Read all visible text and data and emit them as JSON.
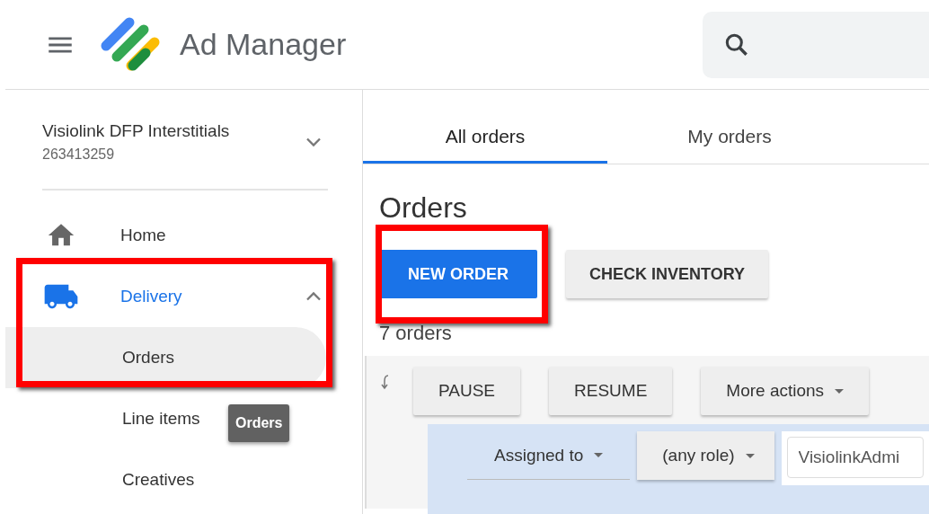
{
  "header": {
    "product": "Ad Manager"
  },
  "network": {
    "name": "Visiolink DFP Interstitials",
    "id": "263413259"
  },
  "nav": [
    {
      "label": "Home",
      "kind": "home",
      "selected": false
    },
    {
      "label": "Delivery",
      "kind": "delivery",
      "selected": true,
      "expanded": true,
      "children": [
        {
          "label": "Orders",
          "selected": true
        },
        {
          "label": "Line items",
          "selected": false
        },
        {
          "label": "Creatives",
          "selected": false
        }
      ]
    }
  ],
  "tooltip": "Orders",
  "tabs": [
    {
      "label": "All orders",
      "selected": true
    },
    {
      "label": "My orders",
      "selected": false
    }
  ],
  "page_title": "Orders",
  "actions": [
    {
      "label": "NEW ORDER",
      "kind": "primary"
    },
    {
      "label": "CHECK INVENTORY",
      "kind": "secondary"
    }
  ],
  "count": "7 orders",
  "toolbar": [
    {
      "label": "PAUSE",
      "dropdown": false
    },
    {
      "label": "RESUME",
      "dropdown": false
    },
    {
      "label": "More actions",
      "dropdown": true
    }
  ],
  "filter": {
    "field": "Assigned to",
    "role": "(any role)",
    "value": "VisiolinkAdmi"
  }
}
